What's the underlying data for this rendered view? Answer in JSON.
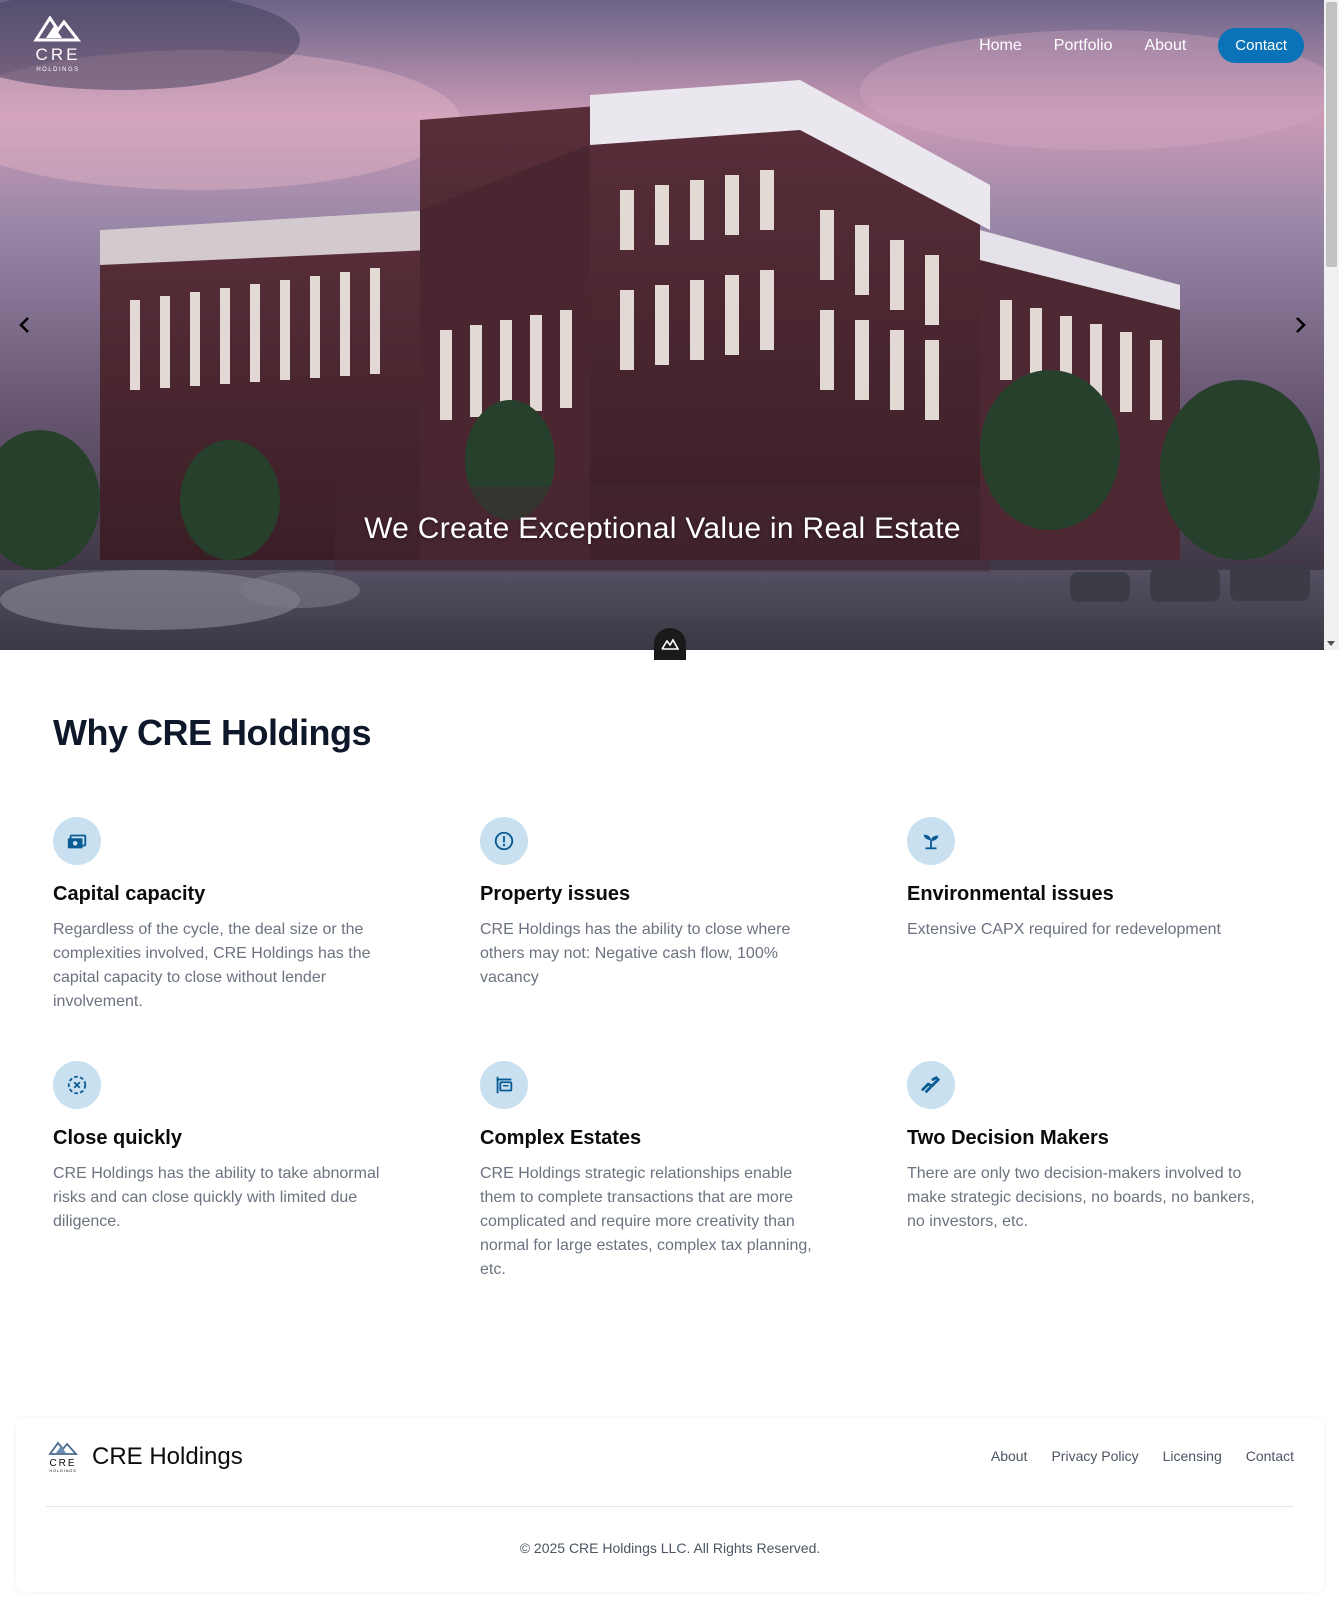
{
  "header": {
    "logo_text": "CRE",
    "logo_subtext": "HOLDINGS",
    "nav": [
      {
        "label": "Home"
      },
      {
        "label": "Portfolio"
      },
      {
        "label": "About"
      }
    ],
    "contact_label": "Contact"
  },
  "hero": {
    "caption": "We Create Exceptional Value in Real Estate",
    "prev_icon": "chevron-left-icon",
    "next_icon": "chevron-right-icon"
  },
  "why": {
    "title": "Why CRE Holdings",
    "features": [
      {
        "icon": "money-icon",
        "title": "Capital capacity",
        "text": "Regardless of the cycle, the deal size or the complexities involved, CRE Holdings has the capital capacity to close without lender involvement."
      },
      {
        "icon": "alert-circle-icon",
        "title": "Property issues",
        "text": "CRE Holdings has the ability to close where others may not: Negative cash flow, 100% vacancy"
      },
      {
        "icon": "plant-icon",
        "title": "Environmental issues",
        "text": "Extensive CAPX required for redevelopment"
      },
      {
        "icon": "timer-off-icon",
        "title": "Close quickly",
        "text": "CRE Holdings has the ability to take abnormal risks and can close quickly with limited due diligence."
      },
      {
        "icon": "estate-sign-icon",
        "title": "Complex Estates",
        "text": "CRE Holdings strategic relationships enable them to complete transactions that are more complicated and require more creativity than normal for large estates, complex tax planning, etc."
      },
      {
        "icon": "handshake-icon",
        "title": "Two Decision Makers",
        "text": "There are only two decision-makers involved to make strategic decisions, no boards, no bankers, no investors, etc."
      }
    ]
  },
  "footer": {
    "brand": "CRE Holdings",
    "links": [
      "About",
      "Privacy Policy",
      "Licensing",
      "Contact"
    ],
    "copyright": "© 2025 CRE Holdings LLC. All Rights Reserved."
  },
  "colors": {
    "accent": "#0a73b8",
    "icon_bg": "#c8e0f0",
    "icon_fg": "#0a5a93",
    "title": "#0f172a",
    "body_text": "#6b7280"
  }
}
